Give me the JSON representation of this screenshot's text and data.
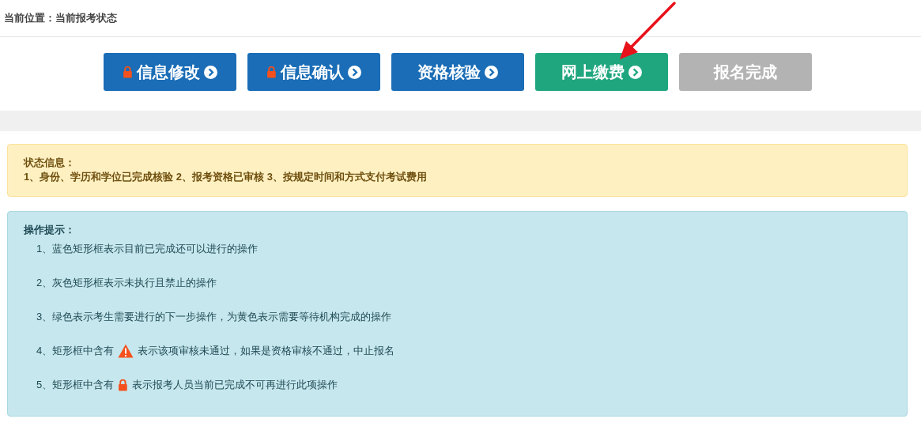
{
  "breadcrumb": {
    "label": "当前位置：",
    "current": "当前报考状态"
  },
  "steps": [
    {
      "label": "信息修改",
      "kind": "done",
      "locked": true,
      "chevron": true
    },
    {
      "label": "信息确认",
      "kind": "done",
      "locked": true,
      "chevron": true
    },
    {
      "label": "资格核验",
      "kind": "done",
      "locked": false,
      "chevron": true
    },
    {
      "label": "网上缴费",
      "kind": "current",
      "locked": false,
      "chevron": true
    },
    {
      "label": "报名完成",
      "kind": "disabled",
      "locked": false,
      "chevron": false
    }
  ],
  "status_alert": {
    "title": "状态信息：",
    "text": "1、身份、学历和学位已完成核验 2、报考资格已审核 3、按规定时间和方式支付考试费用"
  },
  "tips_alert": {
    "title": "操作提示：",
    "items": [
      {
        "kind": "text",
        "text": "1、蓝色矩形框表示目前已完成还可以进行的操作"
      },
      {
        "kind": "text",
        "text": "2、灰色矩形框表示未执行且禁止的操作"
      },
      {
        "kind": "text",
        "text": "3、绿色表示考生需要进行的下一步操作，为黄色表示需要等待机构完成的操作"
      },
      {
        "kind": "warning",
        "before": "4、矩形框中含有",
        "after": "表示该项审核未通过，如果是资格审核不通过，中止报名"
      },
      {
        "kind": "lock",
        "before": "5、矩形框中含有",
        "after": "表示报考人员当前已完成不可再进行此项操作"
      }
    ]
  }
}
